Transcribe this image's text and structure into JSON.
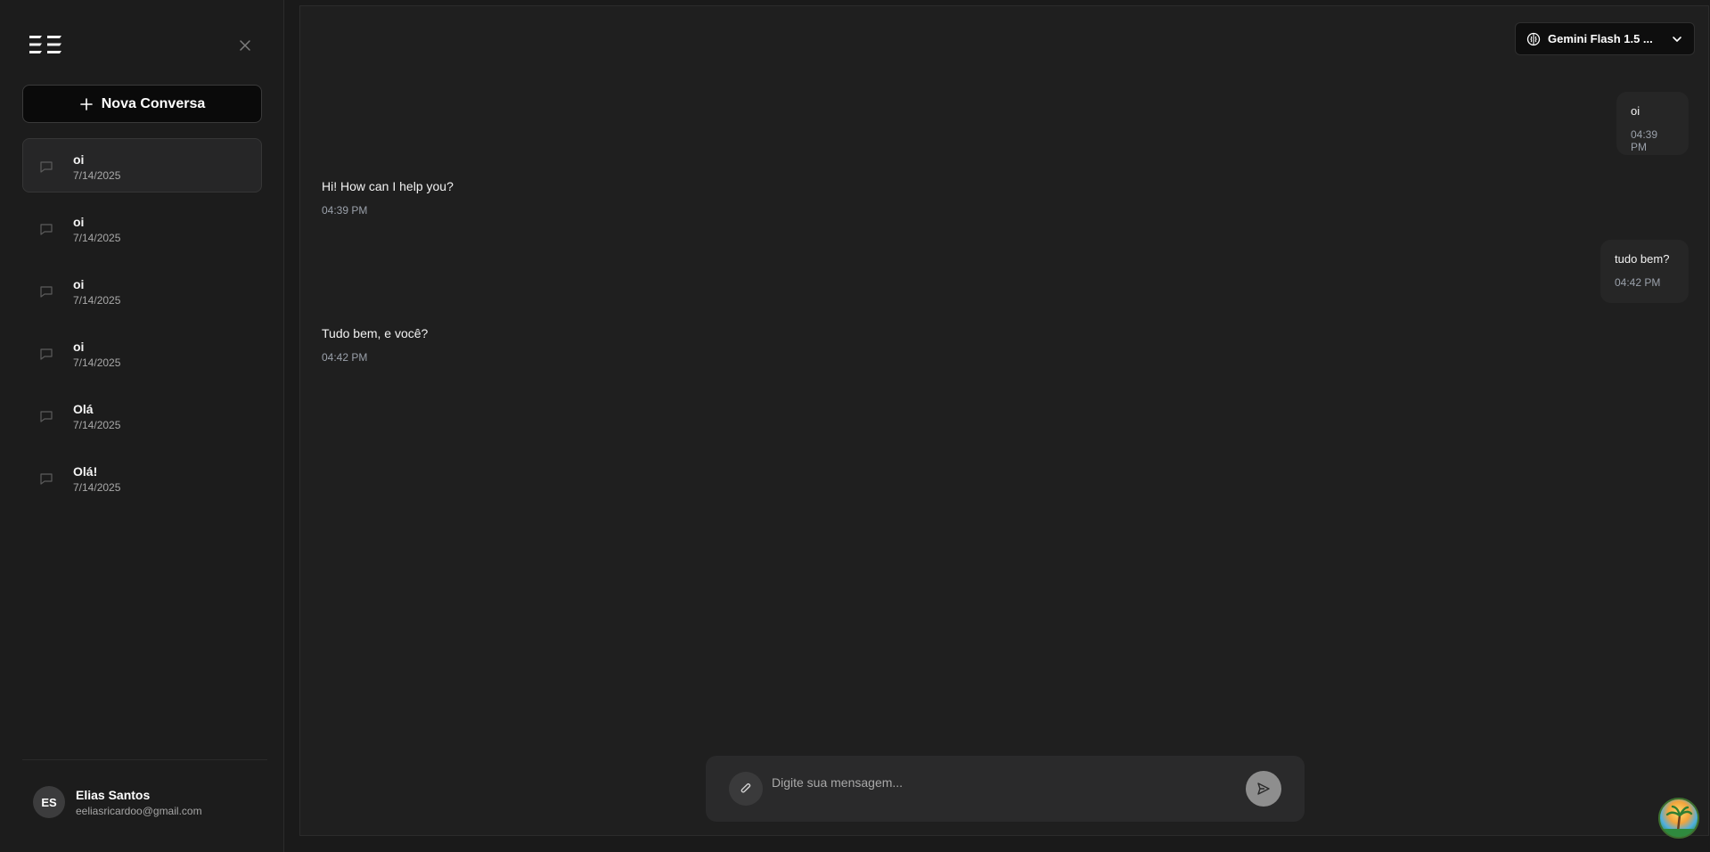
{
  "sidebar": {
    "new_chat_label": "Nova Conversa",
    "conversations": [
      {
        "title": "oi",
        "date": "7/14/2025",
        "active": true
      },
      {
        "title": "oi",
        "date": "7/14/2025"
      },
      {
        "title": "oi",
        "date": "7/14/2025"
      },
      {
        "title": "oi",
        "date": "7/14/2025"
      },
      {
        "title": "Olá",
        "date": "7/14/2025"
      },
      {
        "title": "Olá!",
        "date": "7/14/2025"
      }
    ],
    "user": {
      "initials": "ES",
      "name": "Elias Santos",
      "email": "eeliasricardoo@gmail.com"
    }
  },
  "header": {
    "model_label": "Gemini Flash 1.5 ..."
  },
  "messages": [
    {
      "role": "user",
      "text": "oi",
      "time": "04:39 PM"
    },
    {
      "role": "assistant",
      "text": "Hi! How can I help you?",
      "time": "04:39 PM"
    },
    {
      "role": "user",
      "text": "tudo bem?",
      "time": "04:42 PM"
    },
    {
      "role": "assistant",
      "text": "Tudo bem, e você?",
      "time": "04:42 PM"
    }
  ],
  "composer": {
    "placeholder": "Digite sua mensagem..."
  },
  "icons": {
    "logo": "logo-icon",
    "close": "close-icon",
    "plus": "plus-icon",
    "chat": "chat-bubble-icon",
    "model": "brain-icon",
    "chevron": "chevron-down-icon",
    "attach": "paperclip-icon",
    "send": "send-icon",
    "fab": "assistant-avatar-icon"
  },
  "colors": {
    "background": "#1a1a1a",
    "sidebar": "#1c1c1c",
    "main": "#1f1f1f",
    "bubble": "#262626",
    "timestamp": "#9aa0aa",
    "send_button": "#8e8e8e"
  }
}
